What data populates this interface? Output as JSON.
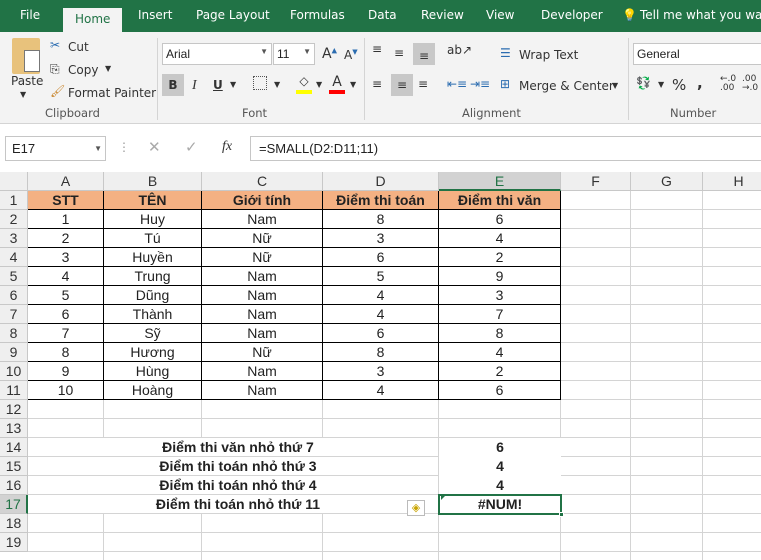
{
  "tabs": [
    "File",
    "Home",
    "Insert",
    "Page Layout",
    "Formulas",
    "Data",
    "Review",
    "View",
    "Developer"
  ],
  "tell_me": "Tell me what you want",
  "clipboard": {
    "paste": "Paste",
    "cut": "Cut",
    "copy": "Copy",
    "format_painter": "Format Painter",
    "group": "Clipboard"
  },
  "font": {
    "name": "Arial",
    "size": "11",
    "group": "Font",
    "bold": "B",
    "italic": "I",
    "underline": "U"
  },
  "alignment": {
    "wrap": "Wrap Text",
    "merge": "Merge & Center",
    "group": "Alignment"
  },
  "number": {
    "format": "General",
    "percent": "%",
    "comma": ",",
    "group": "Number"
  },
  "formula_bar": {
    "name_box": "E17",
    "fx": "fx",
    "formula": "=SMALL(D2:D11;11)"
  },
  "columns": [
    "A",
    "B",
    "C",
    "D",
    "E",
    "F",
    "G",
    "H"
  ],
  "rows": [
    "1",
    "2",
    "3",
    "4",
    "5",
    "6",
    "7",
    "8",
    "9",
    "10",
    "11",
    "12",
    "13",
    "14",
    "15",
    "16",
    "17",
    "18",
    "19"
  ],
  "table": {
    "headers": [
      "STT",
      "TÊN",
      "Giới tính",
      "Điểm thi toán",
      "Điểm thi văn"
    ],
    "rows": [
      [
        "1",
        "Huy",
        "Nam",
        "8",
        "6"
      ],
      [
        "2",
        "Tú",
        "Nữ",
        "3",
        "4"
      ],
      [
        "3",
        "Huyền",
        "Nữ",
        "6",
        "2"
      ],
      [
        "4",
        "Trung",
        "Nam",
        "5",
        "9"
      ],
      [
        "5",
        "Dũng",
        "Nam",
        "4",
        "3"
      ],
      [
        "6",
        "Thành",
        "Nam",
        "4",
        "7"
      ],
      [
        "7",
        "Sỹ",
        "Nam",
        "6",
        "8"
      ],
      [
        "8",
        "Hương",
        "Nữ",
        "8",
        "4"
      ],
      [
        "9",
        "Hùng",
        "Nam",
        "3",
        "2"
      ],
      [
        "10",
        "Hoàng",
        "Nam",
        "4",
        "6"
      ]
    ]
  },
  "results": [
    {
      "label": "Điểm thi văn nhỏ thứ 7",
      "value": "6"
    },
    {
      "label": "Điểm thi toán nhỏ thứ 3",
      "value": "4"
    },
    {
      "label": "Điểm thi toán nhỏ thứ 4",
      "value": "4"
    },
    {
      "label": "Điểm thi toán nhỏ thứ 11",
      "value": "#NUM!"
    }
  ],
  "colors": {
    "brand": "#217346",
    "header_fill": "#f4b183",
    "selection": "#217346"
  }
}
